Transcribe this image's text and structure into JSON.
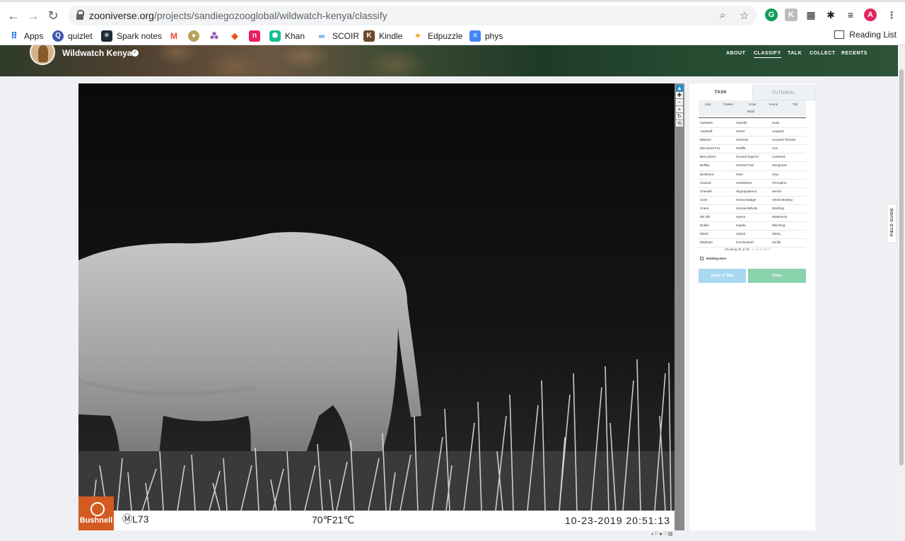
{
  "browser": {
    "url_host": "zooniverse.org",
    "url_path": "/projects/sandiegozooglobal/wildwatch-kenya/classify",
    "profile_initial": "A"
  },
  "bookmarks": {
    "items": [
      {
        "label": "Apps",
        "icon": "apps-grid-icon"
      },
      {
        "label": "quizlet",
        "icon": "quizlet-icon"
      },
      {
        "label": "Spark notes",
        "icon": "sparknotes-icon"
      },
      {
        "label": "",
        "icon": "gmail-icon"
      },
      {
        "label": "",
        "icon": "seal-icon"
      },
      {
        "label": "",
        "icon": "dots-icon"
      },
      {
        "label": "",
        "icon": "diamond-icon"
      },
      {
        "label": "",
        "icon": "n-icon"
      },
      {
        "label": "Khan",
        "icon": "khan-icon"
      },
      {
        "label": "SCOIR",
        "icon": "scoir-icon"
      },
      {
        "label": "Kindle",
        "icon": "kindle-icon"
      },
      {
        "label": "Edpuzzle",
        "icon": "edpuzzle-icon"
      },
      {
        "label": "phys",
        "icon": "docs-icon"
      }
    ],
    "reading_list": "Reading List"
  },
  "project": {
    "name": "Wildwatch Kenya",
    "nav": [
      "ABOUT",
      "CLASSIFY",
      "TALK",
      "COLLECT",
      "RECENTS"
    ],
    "active_nav": "CLASSIFY"
  },
  "subject": {
    "camera_brand": "Bushnell",
    "camera_id": "ⓂL73",
    "temperature": "70℉21℃",
    "timestamp": "10-23-2019 20:51:13"
  },
  "task_panel": {
    "tabs": [
      "TASK",
      "TUTORIAL"
    ],
    "filters": [
      "Like",
      "Pattern",
      "Color",
      "Horns",
      "Tail",
      "Build"
    ],
    "choices": [
      [
        "Aardvark",
        "Gazelle",
        "Kudu"
      ],
      [
        "Aardwolf",
        "Genet",
        "Leopard"
      ],
      [
        "Baboon",
        "Gerenuk",
        "Leopard Tortoise"
      ],
      [
        "Bat-eared Fox",
        "Giraffe",
        "Lion"
      ],
      [
        "Bird (other)",
        "Ground Squirrel",
        "Livestock"
      ],
      [
        "Buffalo",
        "Guinea Fowl",
        "Mongoose"
      ],
      [
        "Bushbuck",
        "Hare",
        "Oryx"
      ],
      [
        "Caracal",
        "Hartebeest",
        "Porcupine"
      ],
      [
        "Cheetah",
        "Hippopotamus",
        "Serval"
      ],
      [
        "Civet",
        "Honey Badger",
        "Velvet Monkey"
      ],
      [
        "Crane",
        "Human/Vehicle",
        "Warthog"
      ],
      [
        "Dik Dik",
        "Hyena",
        "Waterbuck"
      ],
      [
        "Duiker",
        "Impala",
        "Wild Dog"
      ],
      [
        "Eland",
        "Jackal",
        "Zebra"
      ],
      [
        "Elephant",
        "Kori Bustard",
        "Zorilla"
      ]
    ],
    "showing": "Showing 45 of 45",
    "clear_filters": "Clear filters",
    "nothing_here": "Nothing Here",
    "done_talk": "Done & Talk",
    "done": "Done"
  },
  "field_guide": "FIELD GUIDE"
}
